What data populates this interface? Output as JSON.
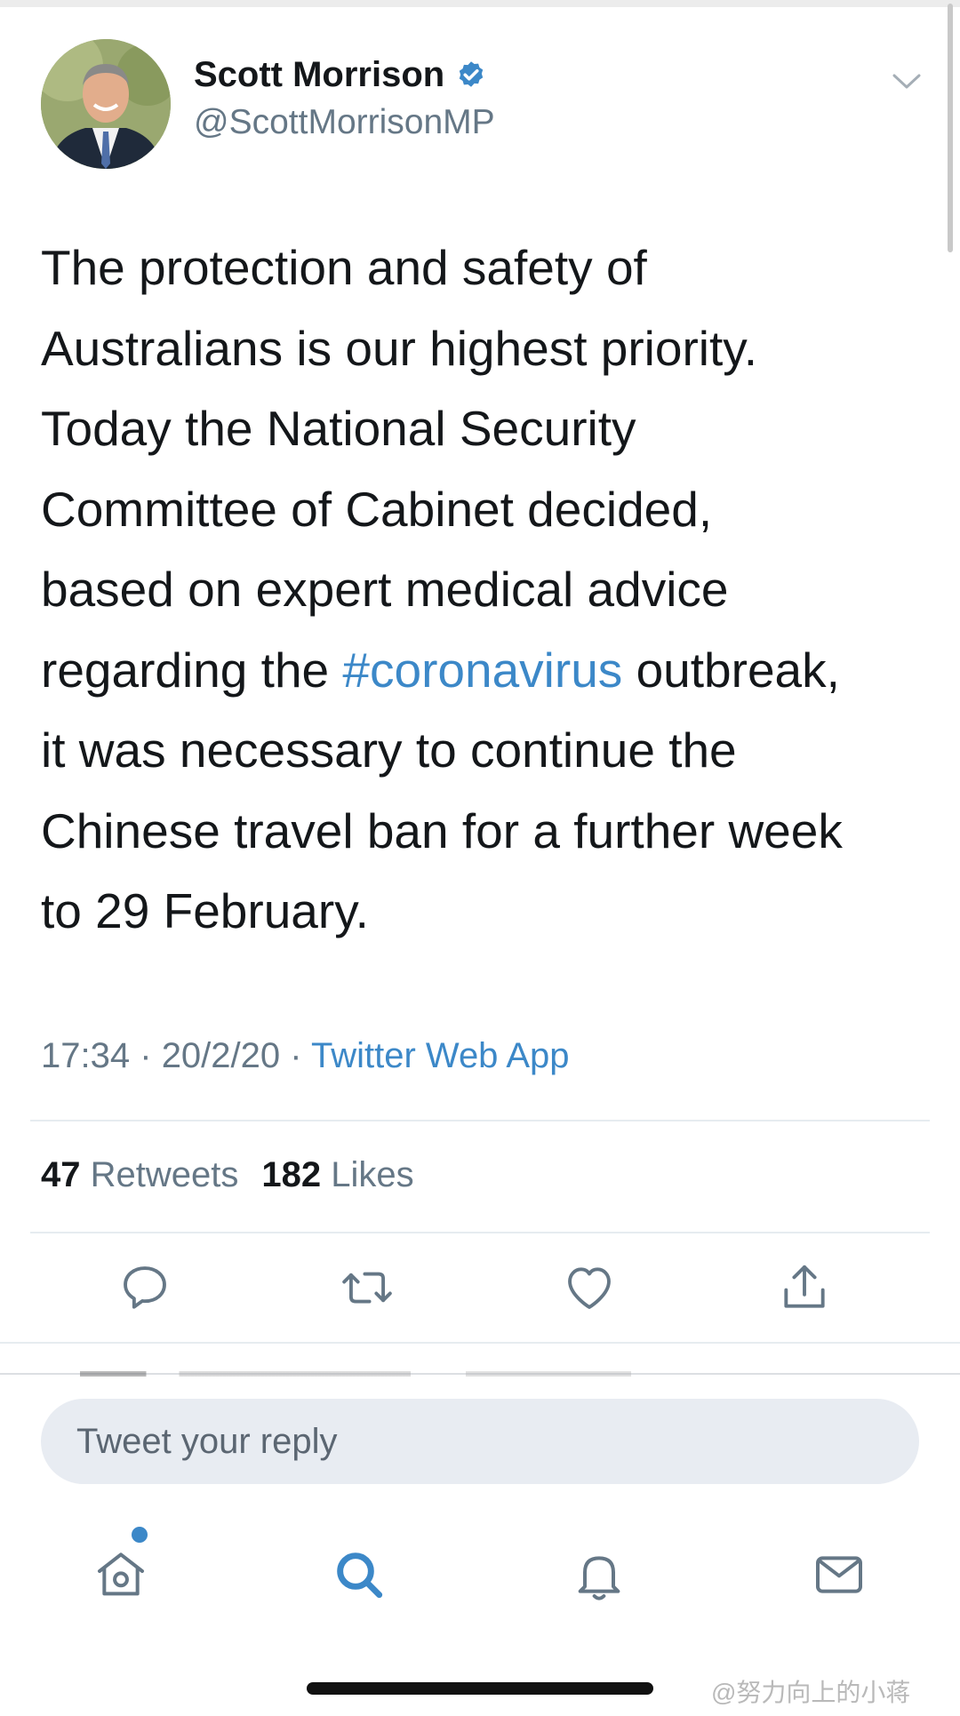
{
  "colors": {
    "accent": "#3c88c8",
    "secondary_text": "#657786",
    "primary_text": "#14171a"
  },
  "author": {
    "name": "Scott Morrison",
    "handle": "@ScottMorrisonMP",
    "verified": true
  },
  "tweet": {
    "lines": [
      "The protection and safety of",
      "Australians is our highest priority.",
      "Today the National Security",
      "Committee of Cabinet decided,",
      "based on expert medical advice"
    ],
    "line6_before": "regarding the ",
    "hashtag": "#coronavirus",
    "line6_after": " outbreak,",
    "lines_end": [
      "it was necessary to continue the",
      "Chinese travel ban for a further week",
      "to 29 February."
    ]
  },
  "meta": {
    "time": "17:34",
    "sep": "·",
    "date": "20/2/20",
    "source": "Twitter Web App"
  },
  "stats": {
    "retweets_count": "47",
    "retweets_label": "Retweets",
    "likes_count": "182",
    "likes_label": "Likes"
  },
  "actions": {
    "icons": [
      "reply-icon",
      "retweet-icon",
      "like-icon",
      "share-icon"
    ]
  },
  "reply": {
    "placeholder": "Tweet your reply"
  },
  "nav": {
    "icons": [
      "home-icon",
      "search-icon",
      "notifications-icon",
      "messages-icon"
    ],
    "home_has_notification": true
  },
  "watermark": "@努力向上的小蒋"
}
